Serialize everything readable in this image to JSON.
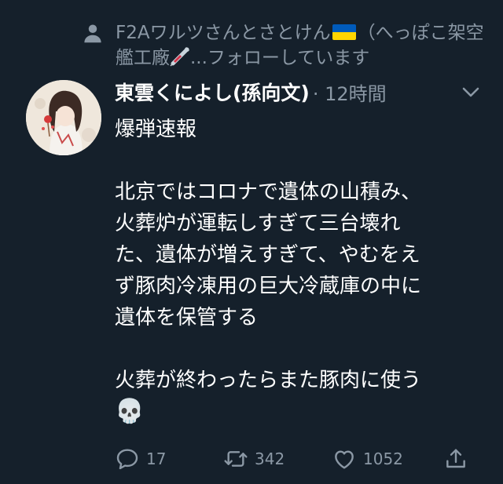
{
  "social_context": {
    "icon": "person-icon",
    "text_before_flag": "F2Aワルツさんとさとけん",
    "text_after_flag": "（へっぽこ架空艦工廠",
    "text_after_syringe": "...フォローしています",
    "flag_colors": [
      "#005bbb",
      "#ffd500"
    ]
  },
  "tweet": {
    "avatar": "avatar",
    "display_name": "東雲くによし(孫向文)",
    "meta": "· 12時間",
    "more_icon": "chevron-down-icon",
    "lines": [
      "爆弾速報",
      "",
      "北京ではコロナで遺体の山積み、",
      "火葬炉が運転しすぎて三台壊れ",
      "た、遺体が増えすぎて、やむをえ",
      "ず豚肉冷凍用の巨大冷蔵庫の中に",
      "遺体を保管する",
      "",
      "火葬が終わったらまた豚肉に使う"
    ],
    "emoji": "💀"
  },
  "actions": {
    "reply_count": "17",
    "retweet_count": "342",
    "like_count": "1052",
    "icons": [
      "reply-icon",
      "retweet-icon",
      "like-icon",
      "share-icon"
    ]
  },
  "colors": {
    "background": "#15202b",
    "secondary_text": "#8b98a5",
    "primary_text": "#ffffff"
  }
}
